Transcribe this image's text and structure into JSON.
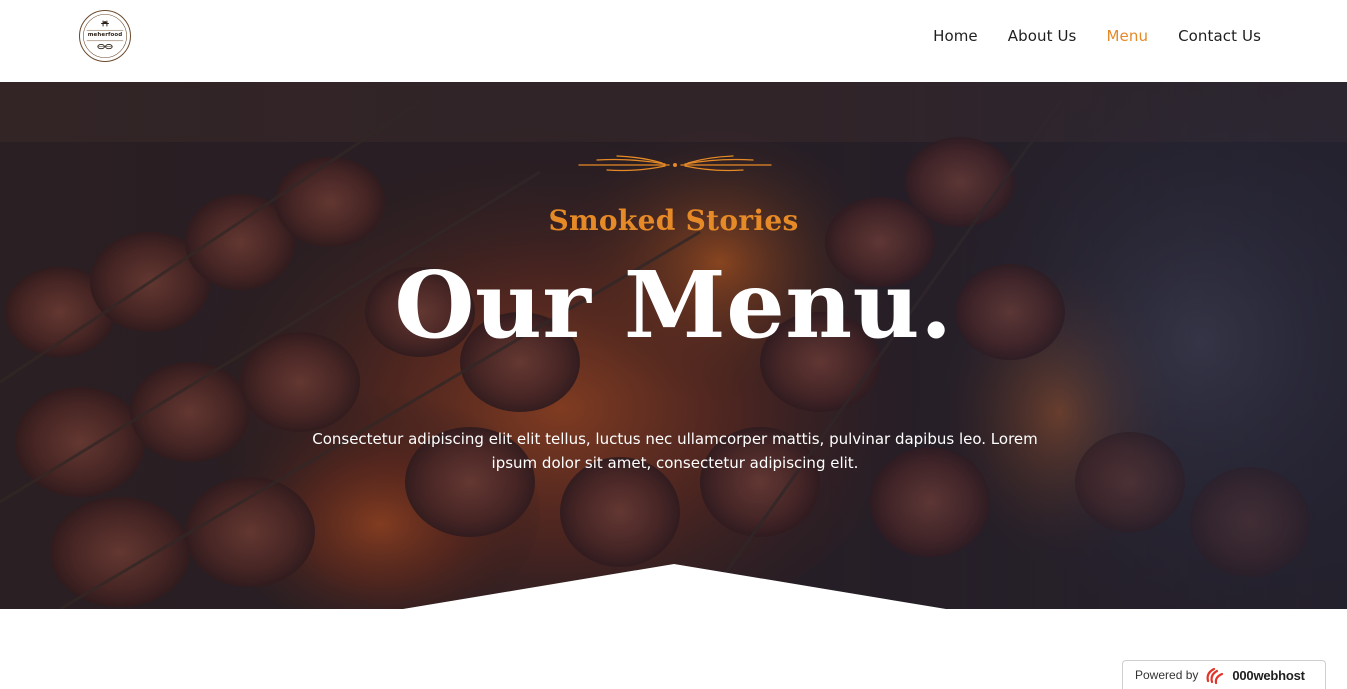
{
  "header": {
    "logo_text": "meherfood",
    "nav": [
      {
        "label": "Home",
        "active": false
      },
      {
        "label": "About Us",
        "active": false
      },
      {
        "label": "Menu",
        "active": true
      },
      {
        "label": "Contact Us",
        "active": false
      }
    ]
  },
  "hero": {
    "kicker": "Smoked Stories",
    "title": "Our Menu.",
    "description": "Consectetur adipiscing elit elit tellus, luctus nec ullamcorper mattis, pulvinar dapibus leo. Lorem ipsum dolor sit amet, consectetur adipiscing elit.",
    "background_image": "grilled-kebab-skewers-over-flames",
    "ornament_icon": "flourish-divider-icon"
  },
  "badge": {
    "powered_by": "Powered by",
    "brand": "000webhost",
    "icon": "000webhost-logo-icon"
  },
  "colors": {
    "accent": "#e58a26",
    "nav_text": "#1f1f1f",
    "hero_text": "#ffffff"
  }
}
